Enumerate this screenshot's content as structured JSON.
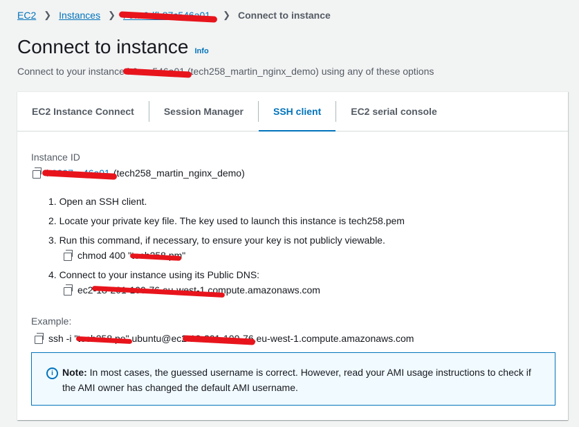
{
  "breadcrumb": {
    "ec2": "EC2",
    "instances": "Instances",
    "instance_id": "i-0…9dfb87c546a01",
    "current": "Connect to instance"
  },
  "header": {
    "title": "Connect to instance",
    "info": "Info",
    "subtitle_prefix": "Connect to your instance ",
    "subtitle_id": "i-0…c546a01",
    "subtitle_suffix": " (tech258_martin_nginx_demo) using any of these options"
  },
  "tabs": [
    {
      "label": "EC2 Instance Connect"
    },
    {
      "label": "Session Manager"
    },
    {
      "label": "SSH client"
    },
    {
      "label": "EC2 serial console"
    }
  ],
  "ssh": {
    "instance_id_label": "Instance ID",
    "instance_id": "i-0397…46a01",
    "instance_name": "(tech258_martin_nginx_demo)",
    "steps": [
      "1. Open an SSH client.",
      "2. Locate your private key file. The key used to launch this instance is tech258.pem",
      "3. Run this command, if necessary, to ensure your key is not publicly viewable.",
      "4. Connect to your instance using its Public DNS:"
    ],
    "chmod_prefix": "chmod 400 \"t",
    "chmod_redacted": "ech258.p",
    "chmod_suffix": "m\"",
    "dns_prefix": "ec2-",
    "dns_redacted": "18-201-100-76.eu-west-1.co",
    "dns_suffix": "mpute.amazonaws.com",
    "example_label": "Example:",
    "example_prefix": "ssh -i \"t",
    "example_redacted1": "ech258.pe",
    "example_middle": "\" ubuntu@ec2",
    "example_redacted2": "-18-201-100-7",
    "example_suffix": "6.eu-west-1.compute.amazonaws.com"
  },
  "note": {
    "bold": "Note:",
    "text": " In most cases, the guessed username is correct. However, read your AMI usage instructions to check if the AMI owner has changed the default AMI username."
  },
  "colors": {
    "link": "#0073bb",
    "redaction": "#e8141c",
    "note_bg": "#f1faff"
  }
}
